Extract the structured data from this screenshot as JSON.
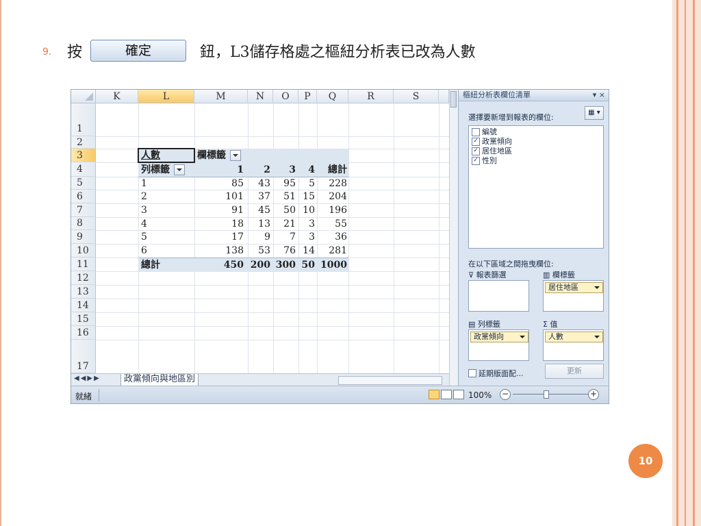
{
  "slide": {
    "bullet_number": "9.",
    "instruction_prefix": "按",
    "ok_button_label": "確定",
    "instruction_suffix": "鈕，L3儲存格處之樞紐分析表已改為人數",
    "page_number": "10"
  },
  "spreadsheet": {
    "columns": [
      "K",
      "L",
      "M",
      "N",
      "O",
      "P",
      "Q",
      "R",
      "S"
    ],
    "rows": [
      "1",
      "2",
      "3",
      "4",
      "5",
      "6",
      "7",
      "8",
      "9",
      "10",
      "11",
      "12",
      "13",
      "14",
      "15",
      "16",
      "17"
    ],
    "pivot": {
      "value_field": "人數",
      "column_labels_caption": "欄標籤",
      "row_labels_caption": "列標籤",
      "column_items": [
        "1",
        "2",
        "3",
        "4",
        "總計"
      ],
      "rows": [
        {
          "label": "1",
          "values": [
            "85",
            "43",
            "95",
            "5",
            "228"
          ]
        },
        {
          "label": "2",
          "values": [
            "101",
            "37",
            "51",
            "15",
            "204"
          ]
        },
        {
          "label": "3",
          "values": [
            "91",
            "45",
            "50",
            "10",
            "196"
          ]
        },
        {
          "label": "4",
          "values": [
            "18",
            "13",
            "21",
            "3",
            "55"
          ]
        },
        {
          "label": "5",
          "values": [
            "17",
            "9",
            "7",
            "3",
            "36"
          ]
        },
        {
          "label": "6",
          "values": [
            "138",
            "53",
            "76",
            "14",
            "281"
          ]
        }
      ],
      "total_row": {
        "label": "總計",
        "values": [
          "450",
          "200",
          "300",
          "50",
          "1000"
        ]
      }
    },
    "sheet_tab": "政黨傾向與地區別",
    "status_ready": "就緒",
    "zoom": "100%"
  },
  "field_list": {
    "title": "樞紐分析表欄位清單",
    "choose_prompt": "選擇要新增到報表的欄位:",
    "fields": [
      {
        "name": "編號",
        "checked": false
      },
      {
        "name": "政黨傾向",
        "checked": true
      },
      {
        "name": "居住地區",
        "checked": true
      },
      {
        "name": "性別",
        "checked": true
      }
    ],
    "drag_prompt": "在以下區域之間拖曳欄位:",
    "report_filter_label": "報表篩選",
    "column_labels_label": "欄標籤",
    "row_labels_label": "列標籤",
    "values_label": "值",
    "column_chip": "居住地區",
    "row_chip": "政黨傾向",
    "values_chip": "人數",
    "defer_label": "延期版面配...",
    "update_label": "更新"
  }
}
